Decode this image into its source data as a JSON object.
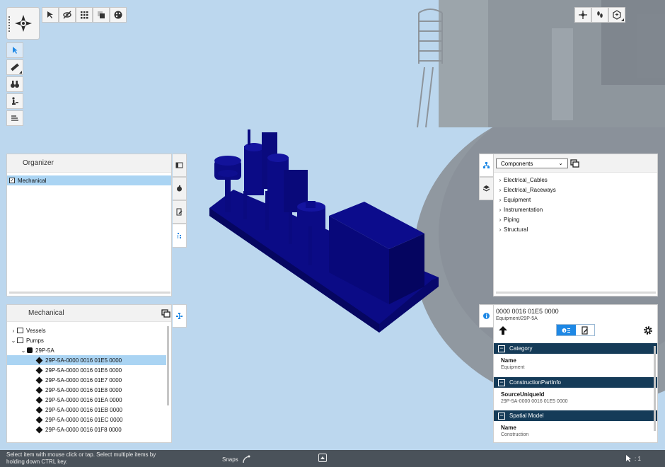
{
  "toolbars": {
    "top_tools": [
      "select-cursor-icon",
      "hide-eye-icon",
      "grid-icon",
      "fade-icon",
      "palette-icon"
    ],
    "left_tools": [
      "select-arrow-icon",
      "measure-ruler-icon",
      "binoculars-icon",
      "person-walk-icon",
      "list-filter-icon"
    ],
    "right_tools": [
      "navigation-icon",
      "footsteps-icon",
      "view-cube-icon"
    ]
  },
  "organizer": {
    "title": "Organizer",
    "items": [
      {
        "label": "Mechanical",
        "checked": true,
        "selected": true
      }
    ],
    "side_tabs": [
      "panel-layout-icon",
      "paint-icon",
      "document-edit-icon",
      "tree-hierarchy-icon"
    ]
  },
  "mechanical": {
    "title": "Mechanical",
    "tree": [
      {
        "label": "Vessels",
        "expanded": false,
        "level": 0
      },
      {
        "label": "Pumps",
        "expanded": true,
        "level": 0
      },
      {
        "label": "29P-5A",
        "expanded": true,
        "level": 1
      },
      {
        "label": "29P-5A-0000 0016 01E5 0000",
        "level": 2,
        "selected": true
      },
      {
        "label": "29P-5A-0000 0016 01E6 0000",
        "level": 2
      },
      {
        "label": "29P-5A-0000 0016 01E7 0000",
        "level": 2
      },
      {
        "label": "29P-5A-0000 0016 01E8 0000",
        "level": 2
      },
      {
        "label": "29P-5A-0000 0016 01EA 0000",
        "level": 2
      },
      {
        "label": "29P-5A-0000 0016 01EB 0000",
        "level": 2
      },
      {
        "label": "29P-5A-0000 0016 01EC 0000",
        "level": 2
      },
      {
        "label": "29P-5A-0000 0016 01F8 0000",
        "level": 2
      }
    ]
  },
  "components": {
    "dropdown": "Components",
    "items": [
      "Electrical_Cables",
      "Electrical_Raceways",
      "Equipment",
      "Instrumentation",
      "Piping",
      "Structural"
    ]
  },
  "properties": {
    "title": "0000 0016 01E5 0000",
    "subtitle": "Equipment/29P-5A",
    "sections": [
      {
        "header": "Category",
        "name": "Name",
        "value": "Equipment"
      },
      {
        "header": "ConstructionPartInfo",
        "name": "SourceUniqueId",
        "value": "29P-5A-0000 0016 01E5 0000"
      },
      {
        "header": "Spatial Model",
        "name": "Name",
        "value": "Construction"
      }
    ]
  },
  "status": {
    "hint_line1": "Select item with mouse click or tap. Select multiple items by",
    "hint_line2": "holding down CTRL key.",
    "snaps_label": "Snaps",
    "selection_count": ": 1"
  },
  "colors": {
    "sky": "#bcd7ee",
    "model": "#0a0a7a",
    "selection": "#aad4f3",
    "section_header": "#153b58",
    "accent": "#1e88e5",
    "status_bar": "#4a525a"
  }
}
